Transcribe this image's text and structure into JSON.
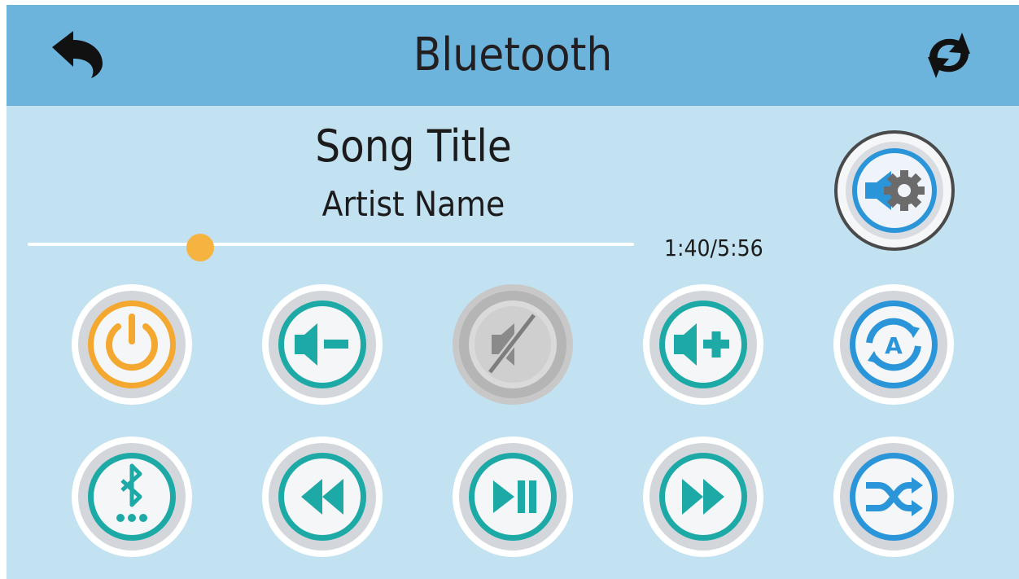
{
  "header": {
    "title": "Bluetooth",
    "back_icon": "back-arrow-icon",
    "refresh_icon": "refresh-icon"
  },
  "now_playing": {
    "song_title": "Song Title",
    "artist_name": "Artist Name",
    "time_display": "1:40/5:56",
    "progress": 0.2844
  },
  "colors": {
    "header_bg": "#6db4dd",
    "screen_bg": "#c2e1f1",
    "teal": "#1daaa6",
    "orange": "#f4a82f",
    "blue": "#2a95d9",
    "grey": "#8a8a8a",
    "progress_thumb": "#f6b340"
  },
  "buttons": {
    "audio_settings": {
      "icon": "speaker-gear-icon"
    },
    "row1": [
      {
        "id": "power",
        "icon": "power-icon",
        "ring": "orange"
      },
      {
        "id": "volume-down",
        "icon": "volume-down-icon",
        "ring": "teal"
      },
      {
        "id": "mute",
        "icon": "mute-icon",
        "ring": "grey"
      },
      {
        "id": "volume-up",
        "icon": "volume-up-icon",
        "ring": "teal"
      },
      {
        "id": "repeat-all",
        "icon": "repeat-a-icon",
        "ring": "blue"
      }
    ],
    "row2": [
      {
        "id": "bluetooth-pair",
        "icon": "bluetooth-icon",
        "ring": "teal"
      },
      {
        "id": "rewind",
        "icon": "rewind-icon",
        "ring": "teal"
      },
      {
        "id": "play-pause",
        "icon": "play-pause-icon",
        "ring": "teal"
      },
      {
        "id": "fast-forward",
        "icon": "fast-forward-icon",
        "ring": "teal"
      },
      {
        "id": "shuffle",
        "icon": "shuffle-icon",
        "ring": "blue"
      }
    ]
  }
}
